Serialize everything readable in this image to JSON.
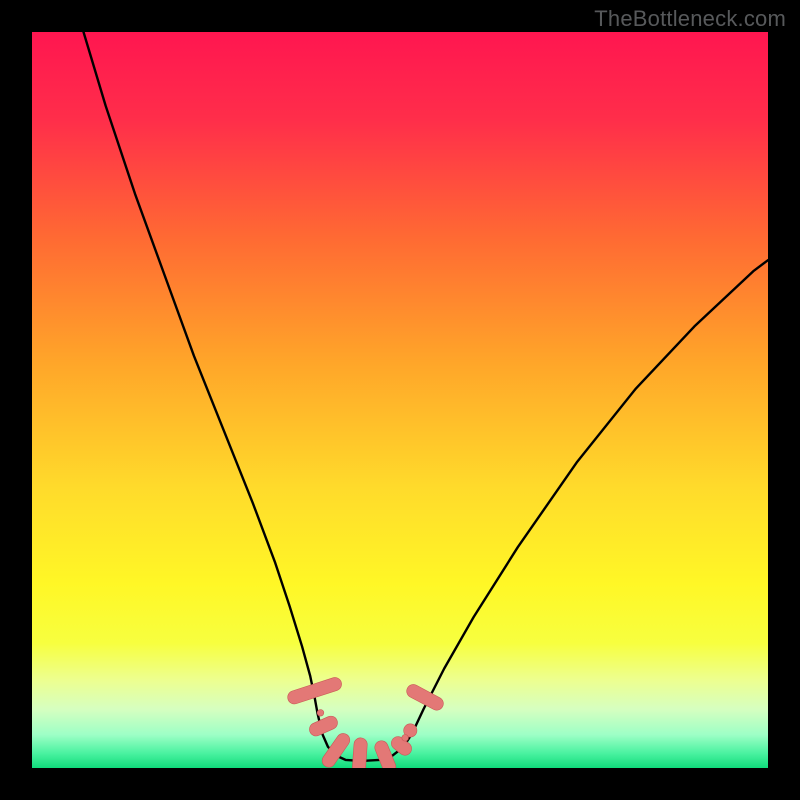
{
  "watermark": "TheBottleneck.com",
  "colors": {
    "frame": "#000000",
    "gradient_top": "#ff1a52",
    "gradient_mid1": "#ff7a2a",
    "gradient_mid2": "#ffe233",
    "gradient_mid3": "#f4ff60",
    "gradient_low": "#b9ffb3",
    "gradient_bottom": "#12e07e",
    "curve": "#000000",
    "marker_fill": "#e37876",
    "marker_stroke": "#c95957"
  },
  "chart_data": {
    "type": "line",
    "title": "",
    "xlabel": "",
    "ylabel": "",
    "xlim": [
      0,
      100
    ],
    "ylim": [
      0,
      100
    ],
    "series": [
      {
        "name": "left-curve",
        "x": [
          7,
          10,
          14,
          18,
          22,
          26,
          30,
          33,
          35,
          36.7,
          37.8,
          38.4,
          38.8,
          39.2,
          39.5,
          40.2,
          41.3,
          42.6,
          44.2,
          45.4
        ],
        "values": [
          100,
          90,
          78,
          67,
          56,
          46,
          36,
          28,
          22,
          16.5,
          12.5,
          9.6,
          7.4,
          5.7,
          4.5,
          2.9,
          1.7,
          1.1,
          1.0,
          1.0
        ]
      },
      {
        "name": "right-curve",
        "x": [
          45.4,
          47.2,
          49.0,
          50.4,
          51.6,
          53.2,
          56.0,
          60.0,
          66.0,
          74.0,
          82.0,
          90.0,
          98.0,
          100.0
        ],
        "values": [
          1.0,
          1.1,
          1.7,
          2.8,
          4.6,
          8.0,
          13.5,
          20.5,
          30.0,
          41.5,
          51.5,
          60.0,
          67.5,
          69.0
        ]
      }
    ],
    "markers": [
      {
        "shape": "pill",
        "cx": 38.4,
        "cy": 10.5,
        "rx": 0.9,
        "ry": 3.8,
        "angle": 72
      },
      {
        "shape": "pill",
        "cx": 39.6,
        "cy": 5.7,
        "rx": 0.9,
        "ry": 2.0,
        "angle": 66
      },
      {
        "shape": "pill",
        "cx": 41.3,
        "cy": 2.4,
        "rx": 0.9,
        "ry": 2.6,
        "angle": 35
      },
      {
        "shape": "pill",
        "cx": 44.5,
        "cy": 1.1,
        "rx": 0.9,
        "ry": 3.0,
        "angle": 4
      },
      {
        "shape": "pill",
        "cx": 48.0,
        "cy": 1.5,
        "rx": 0.9,
        "ry": 2.3,
        "angle": -22
      },
      {
        "shape": "pill",
        "cx": 50.2,
        "cy": 3.0,
        "rx": 0.9,
        "ry": 1.5,
        "angle": -52
      },
      {
        "shape": "dot",
        "cx": 51.4,
        "cy": 5.1,
        "r": 0.9
      },
      {
        "shape": "pill",
        "cx": 53.4,
        "cy": 9.6,
        "rx": 0.9,
        "ry": 2.7,
        "angle": -62
      },
      {
        "shape": "dot",
        "cx": 39.2,
        "cy": 7.5,
        "r": 0.45
      },
      {
        "shape": "dot",
        "cx": 50.7,
        "cy": 4.1,
        "r": 0.45
      }
    ]
  }
}
